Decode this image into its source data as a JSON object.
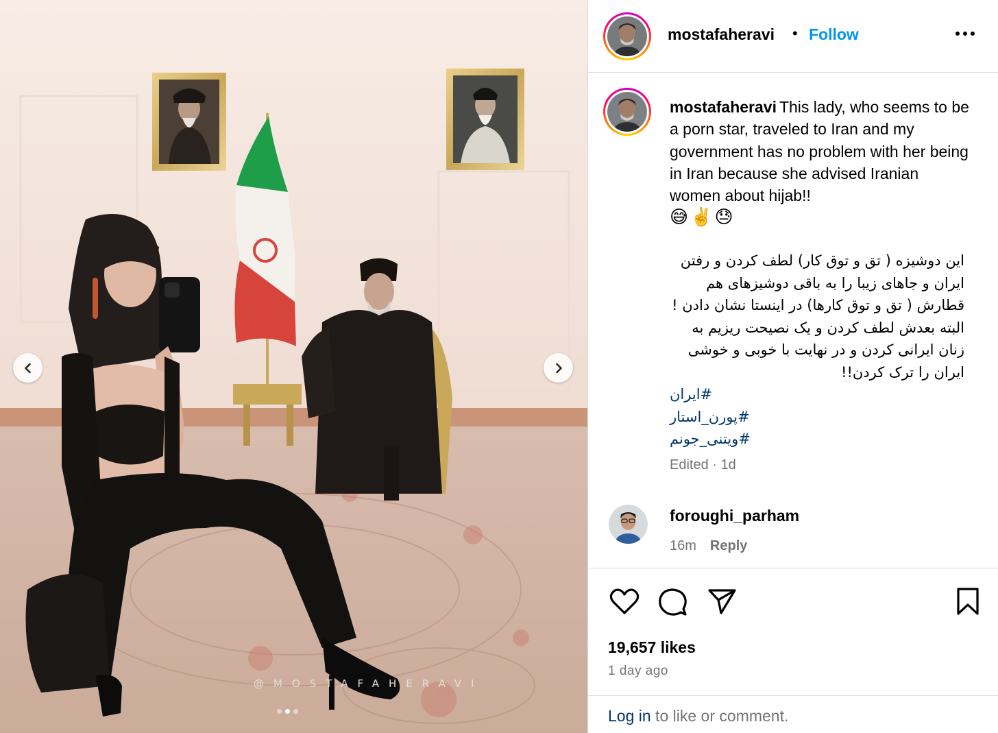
{
  "post": {
    "username": "mostafaheravi",
    "separator": "•",
    "follow_label": "Follow",
    "more_label": "more-options",
    "caption_english": "This lady, who seems to be a porn star, traveled to Iran and my government has no problem with her being in Iran because she advised Iranian women about hijab!!",
    "caption_emojis": "😅✌️😓",
    "caption_persian": "این دوشیزه ( تق و توق کار) لطف کردن و رفتن ایران و جاهای زیبا را به باقی دوشیزهای هم قطارش ( تق و توق کارها) در اینستا نشان دادن ! البته بعدش لطف کردن و یک نصیحت ریزیم به زنان ایرانی کردن و در نهایت با خوبی و خوشی ایران را ترک کردن!!",
    "hashtags": [
      "#ایران",
      "#پورن_استار",
      "#ویتنی_جونم"
    ],
    "edited_label": "Edited · 1d"
  },
  "media": {
    "watermark": "@MOSTAFAHERAVI",
    "prev_label": "previous",
    "next_label": "next",
    "carousel_count": 3,
    "carousel_active": 2
  },
  "comment": {
    "username": "foroughi_parham",
    "time": "16m",
    "reply_label": "Reply"
  },
  "stats": {
    "likes": "19,657 likes",
    "posted": "1 day ago"
  },
  "login": {
    "link": "Log in",
    "rest": " to like or comment."
  },
  "colors": {
    "follow": "#0095f6",
    "hashtag": "#00376b",
    "muted": "#737373",
    "border": "#dbdbdb"
  }
}
